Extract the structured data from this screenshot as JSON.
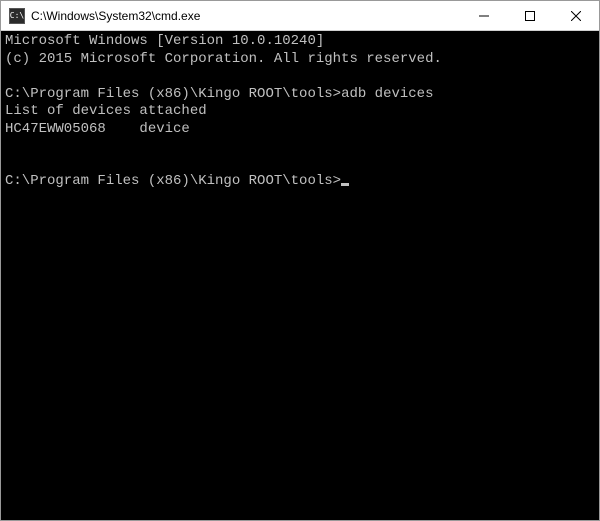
{
  "window": {
    "title": "C:\\Windows\\System32\\cmd.exe",
    "icon_label": "C:\\"
  },
  "terminal": {
    "line1": "Microsoft Windows [Version 10.0.10240]",
    "line2": "(c) 2015 Microsoft Corporation. All rights reserved.",
    "blank1": "",
    "prompt1": "C:\\Program Files (x86)\\Kingo ROOT\\tools>",
    "command1": "adb devices",
    "result1": "List of devices attached",
    "result2": "HC47EWW05068    device",
    "blank2": "",
    "blank3": "",
    "prompt2": "C:\\Program Files (x86)\\Kingo ROOT\\tools>"
  }
}
